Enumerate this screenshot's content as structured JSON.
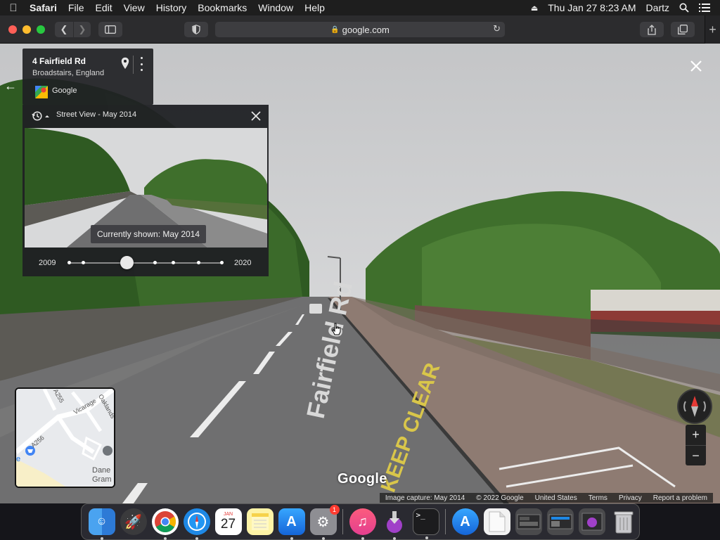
{
  "menubar": {
    "app_name": "Safari",
    "menus": [
      "File",
      "Edit",
      "View",
      "History",
      "Bookmarks",
      "Window",
      "Help"
    ],
    "datetime": "Thu Jan 27  8:23 AM",
    "user": "Dartz"
  },
  "browser": {
    "address": "google.com"
  },
  "place_card": {
    "title": "4 Fairfield Rd",
    "subtitle": "Broadstairs, England",
    "source_label": "Google"
  },
  "time_machine": {
    "header": "Street View - May 2014",
    "tooltip": "Currently shown: May 2014",
    "year_start": "2009",
    "year_end": "2020",
    "selected_fraction": 0.38
  },
  "street": {
    "road_marking": "Fairfield Rd",
    "keep_clear": "KEEP CLEAR"
  },
  "minimap": {
    "labels": [
      "A256",
      "A255",
      "Vicarage",
      "Oaklands",
      "Dane",
      "Gram",
      "e"
    ]
  },
  "watermark": "Google",
  "footer": {
    "capture": "Image capture: May 2014",
    "copyright": "© 2022 Google",
    "region": "United States",
    "terms": "Terms",
    "privacy": "Privacy",
    "report": "Report a problem"
  },
  "dock": {
    "calendar_month": "JAN",
    "calendar_day": "27",
    "settings_badge": "1"
  },
  "colors": {
    "panel": "#202124",
    "sky": "#d4d5d6",
    "road": "#6f6f6f",
    "tree": "#3f6b2a"
  }
}
